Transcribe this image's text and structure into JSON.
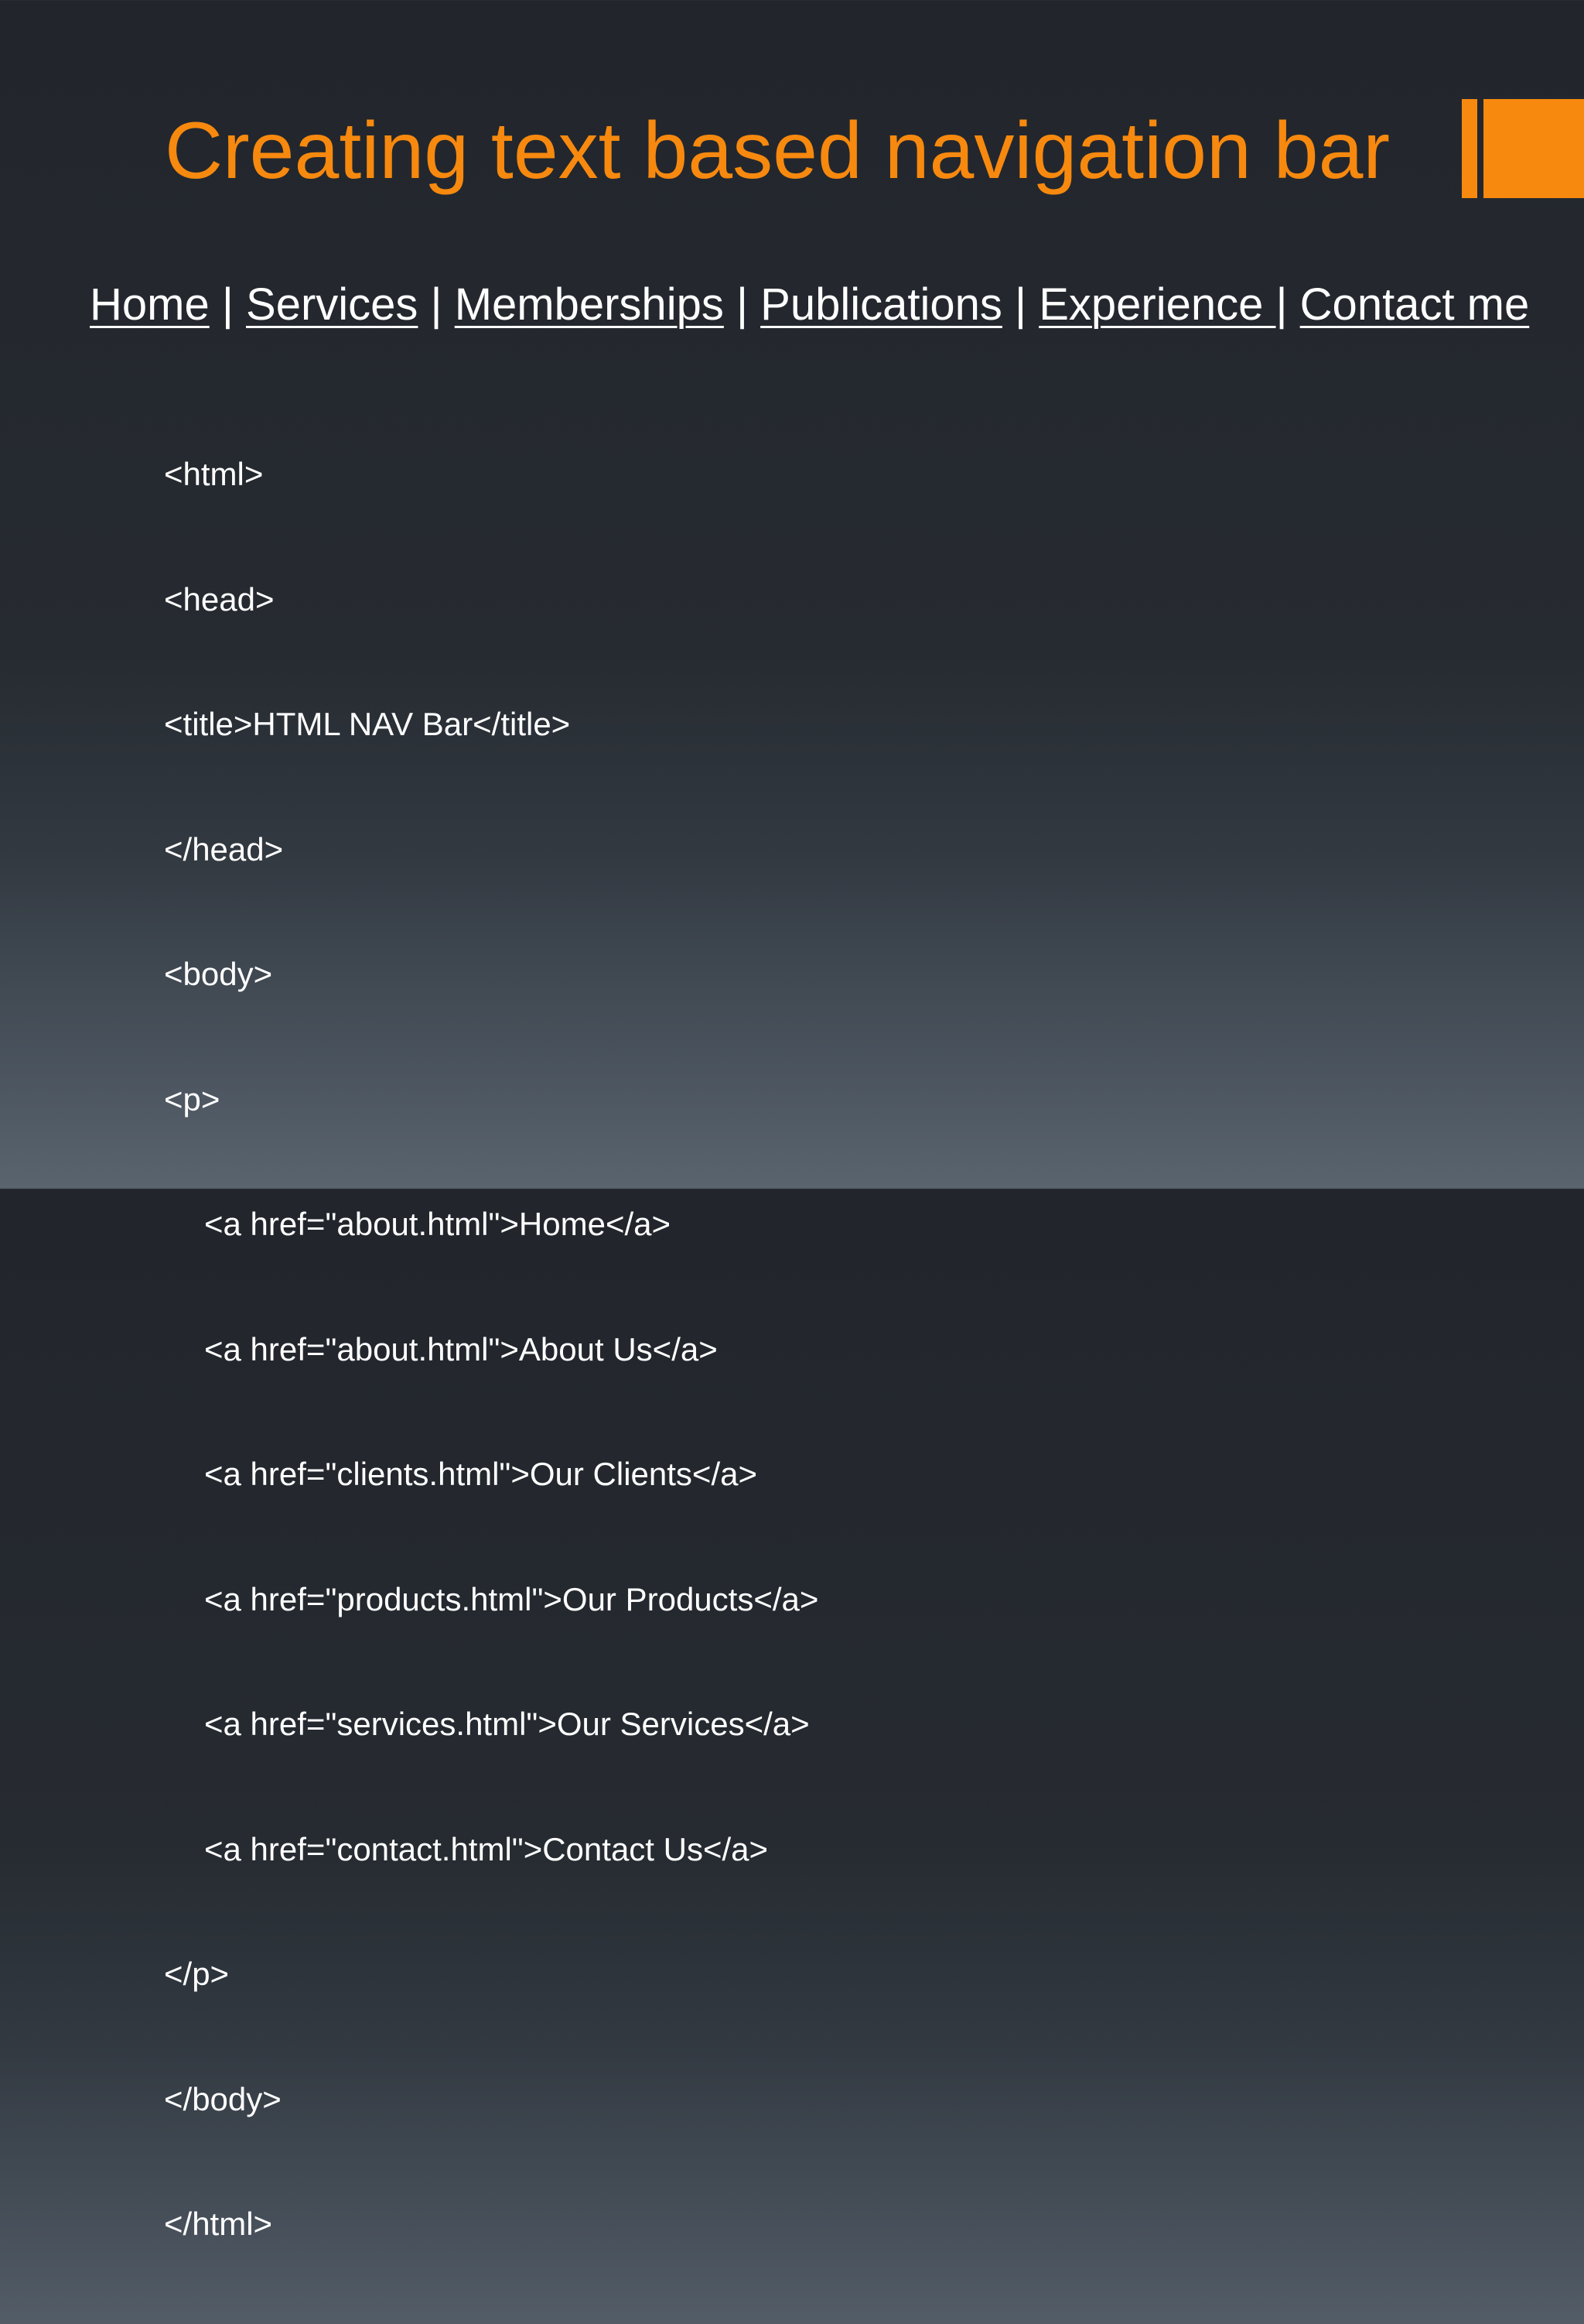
{
  "slide": {
    "title": "Creating text based navigation bar",
    "accent_color": "#f7890f",
    "text_color": "#ffffff"
  },
  "navbar": {
    "links": [
      "Home",
      "Services",
      "Memberships",
      "Publications",
      "Experience ",
      "Contact me"
    ],
    "separator": " | "
  },
  "code": {
    "lines": [
      "<html>",
      "<head>",
      "<title>HTML NAV Bar</title>",
      "</head>",
      "<body>",
      "<p>",
      "<a href=\"about.html\">Home</a>",
      "<a href=\"about.html\">About Us</a>",
      "<a href=\"clients.html\">Our Clients</a>",
      "<a href=\"products.html\">Our Products</a>",
      "<a href=\"services.html\">Our Services</a>",
      "<a href=\"contact.html\">Contact Us</a>",
      "</p>",
      "</body>",
      "</html>"
    ]
  }
}
